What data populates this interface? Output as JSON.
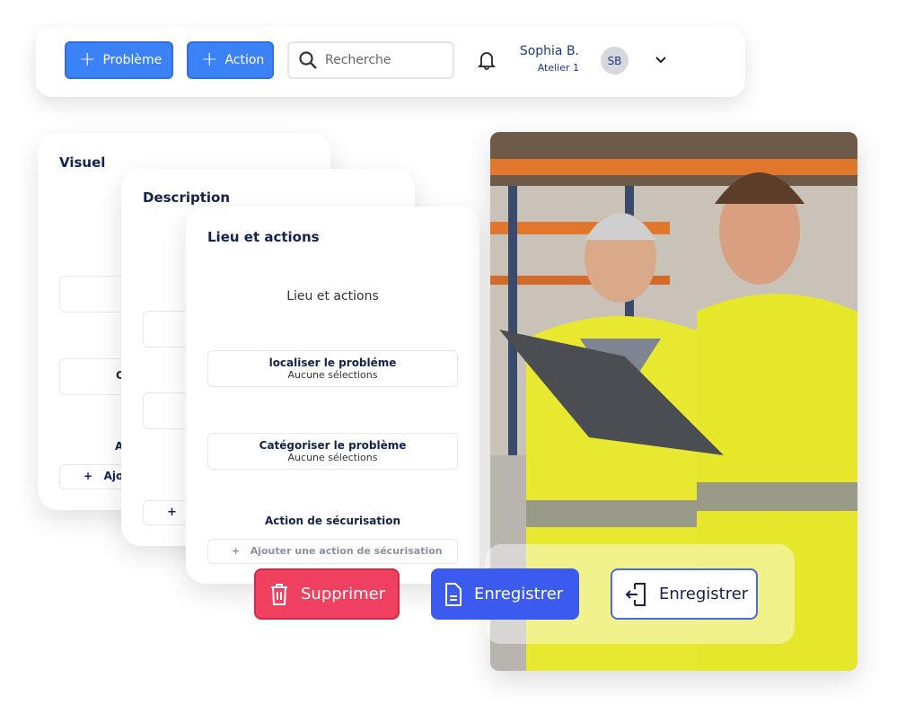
{
  "header": {
    "add_problem": "Problème",
    "add_action": "Action",
    "search_placeholder": "Recherche",
    "user_name": "Sophia B.",
    "user_role": "Atelier 1",
    "avatar_initials": "SB"
  },
  "cards": {
    "visuel": {
      "title": "Visuel",
      "partial_button": "C",
      "partial_label": "A",
      "add_partial": "Ajo"
    },
    "description": {
      "title": "Description"
    },
    "lieu": {
      "title": "Lieu et actions",
      "subtitle": "Lieu et actions",
      "locate": {
        "label": "localiser le probléme",
        "value": "Aucune sélections"
      },
      "categorize": {
        "label": "Catégoriser le problème",
        "value": "Aucune sélections"
      },
      "security_title": "Action de sécurisation",
      "add_security": "Ajouter une action de sécurisation"
    }
  },
  "actions": {
    "delete": "Supprimer",
    "save": "Enregistrer",
    "save_exit": "Enregistrer"
  },
  "colors": {
    "primary": "#3b82f6",
    "danger": "#f0405f",
    "save": "#3b5bef",
    "text": "#14234b"
  }
}
